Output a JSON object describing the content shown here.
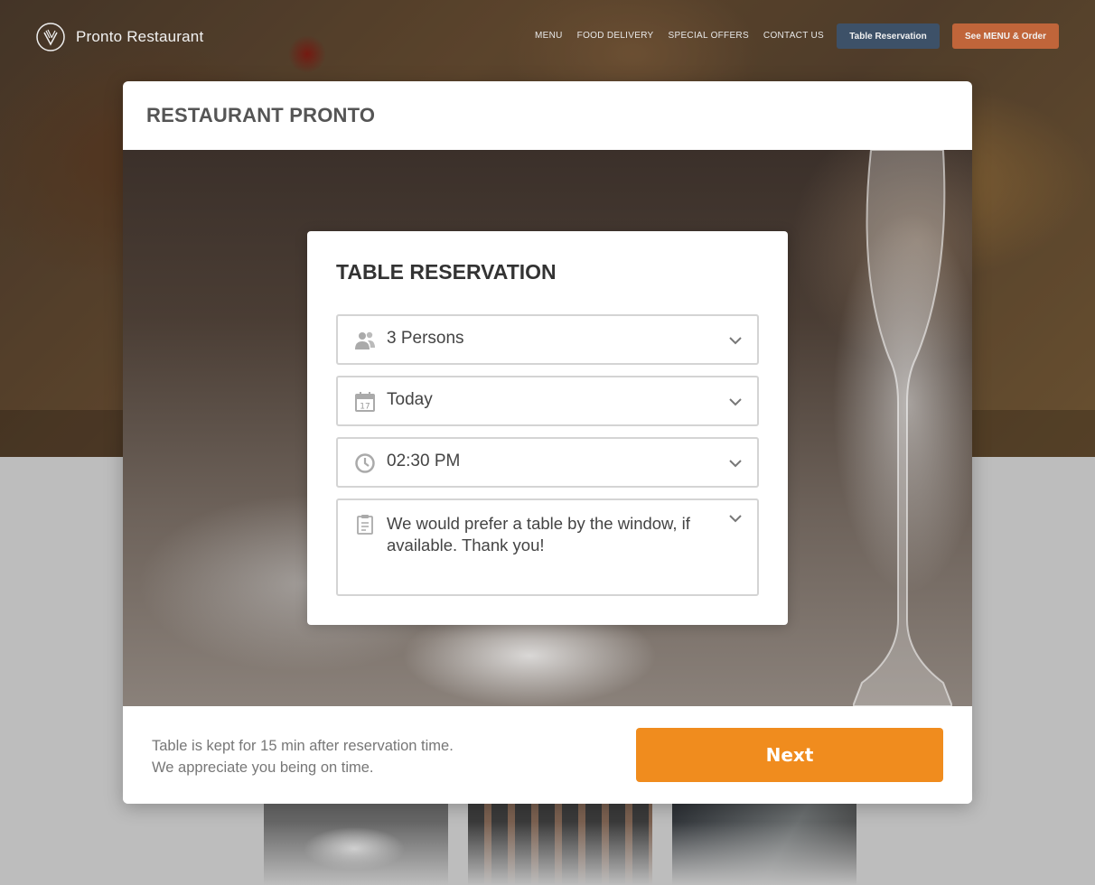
{
  "brand": {
    "name": "Pronto Restaurant",
    "logo_icon": "fork-knife-heart-icon"
  },
  "nav": {
    "links": [
      "MENU",
      "FOOD DELIVERY",
      "SPECIAL OFFERS",
      "CONTACT US"
    ],
    "reservation_button": "Table Reservation",
    "order_button": "See MENU & Order",
    "colors": {
      "reservation_bg": "#3d5168",
      "order_bg": "#c0653a"
    }
  },
  "card": {
    "title": "RESTAURANT PRONTO",
    "footer_line1": "Table is kept for 15 min after reservation time.",
    "footer_line2": "We appreciate you being on time.",
    "next_label": "Next",
    "accent": "#f08c1e"
  },
  "reservation": {
    "title": "TABLE RESERVATION",
    "fields": [
      {
        "icon": "people-icon",
        "value": "3 Persons"
      },
      {
        "icon": "calendar-icon",
        "value": "Today",
        "calendar_day": "17"
      },
      {
        "icon": "clock-icon",
        "value": "02:30 PM"
      },
      {
        "icon": "notes-icon",
        "value": "We would prefer a table by the window, if available. Thank you!"
      }
    ]
  }
}
